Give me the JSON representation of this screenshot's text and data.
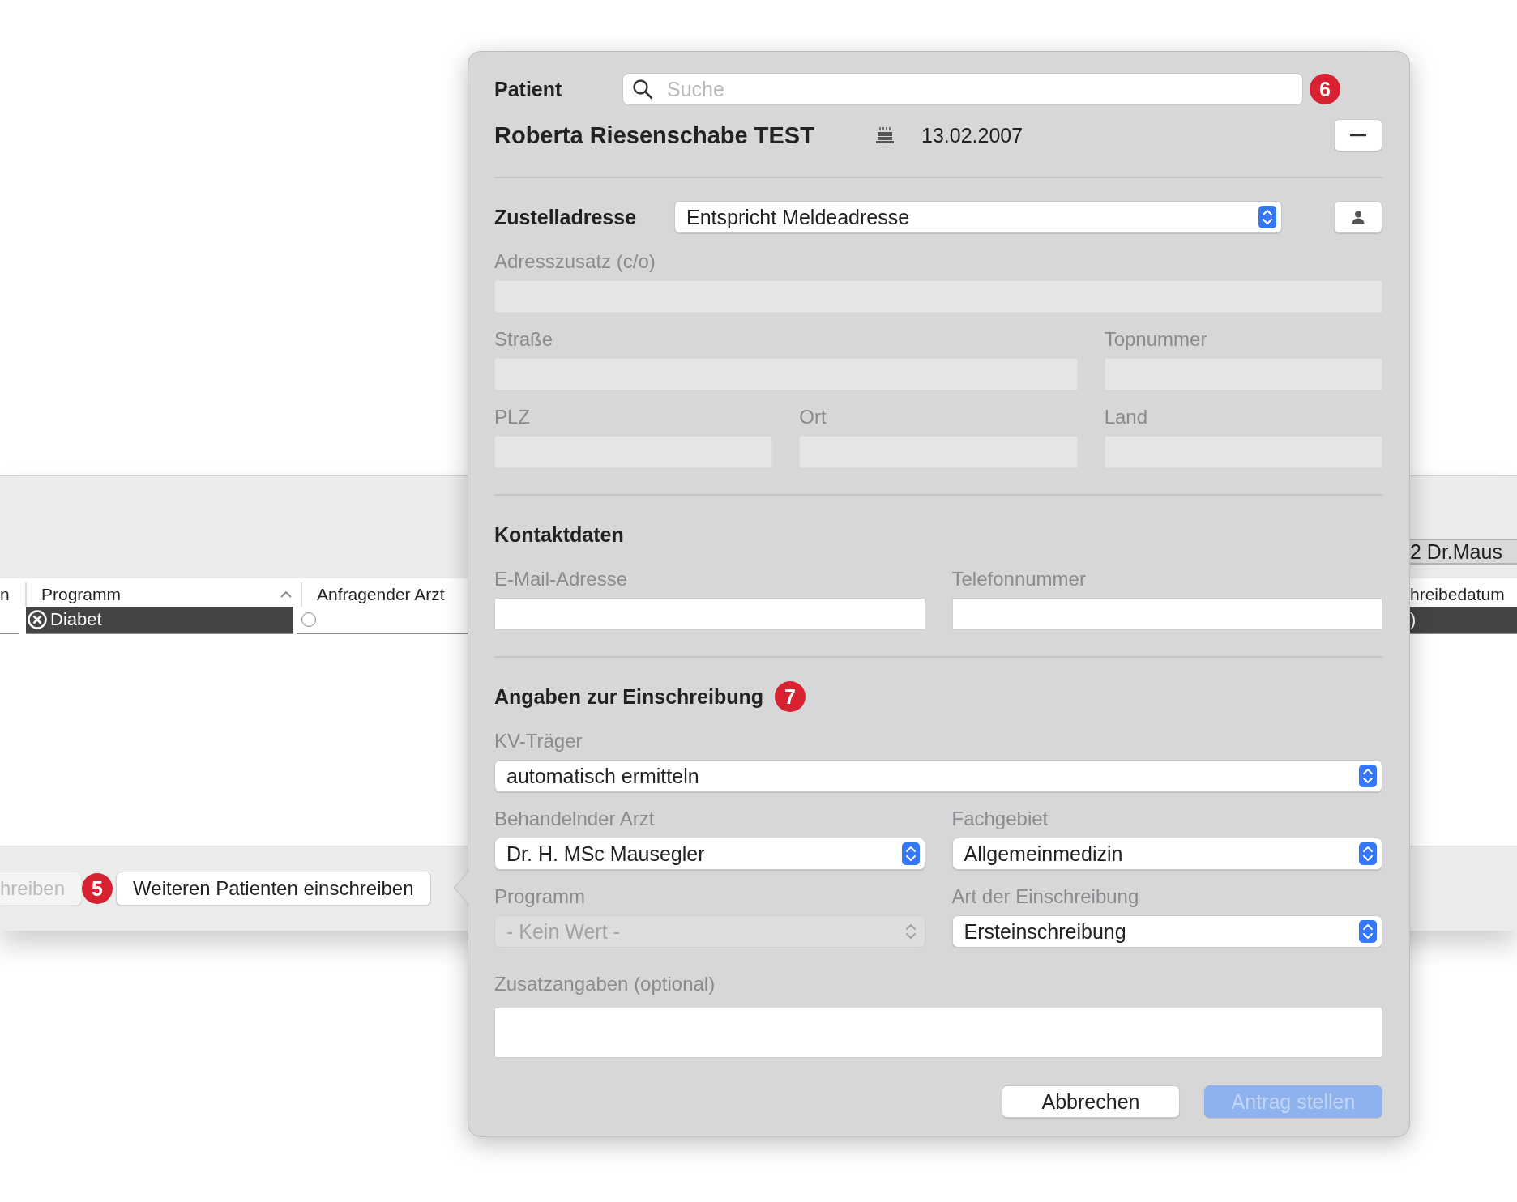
{
  "background_window": {
    "doctor_field": "2 Dr.Maus",
    "columns": [
      {
        "label": "n",
        "sorted": false
      },
      {
        "label": "Programm",
        "sorted": true
      },
      {
        "label": "Anfragender Arzt",
        "sorted": false
      },
      {
        "label": "hreibedatum",
        "sorted": false
      }
    ],
    "rows": [
      {
        "selected": true,
        "program": "Diabet",
        "requesting_doctor_checked": false,
        "column_4": ")"
      }
    ],
    "buttons": [
      {
        "label": "hreiben",
        "disabled": true
      },
      {
        "label": "Weiteren Patienten einschreiben",
        "disabled": false
      }
    ],
    "badge": "5"
  },
  "popover": {
    "patient": {
      "label": "Patient",
      "search_placeholder": "Suche",
      "badge": "6",
      "name": "Roberta Riesenschabe TEST",
      "birth_date": "13.02.2007"
    },
    "sections": [
      {
        "title": "Zustelladresse",
        "title_select": "Entspricht Meldeadresse",
        "rows": [
          [
            {
              "kind": "text",
              "label": "Adresszusatz (c/o)",
              "disabled": true
            },
            "",
            ""
          ],
          [
            {
              "kind": "text",
              "label": "Straße",
              "disabled": true
            },
            "",
            {
              "kind": "text",
              "label": "Topnummer",
              "disabled": true
            }
          ],
          [
            {
              "kind": "text",
              "label": "PLZ",
              "disabled": true
            },
            {
              "kind": "text",
              "label": "Ort",
              "disabled": true
            },
            {
              "kind": "text",
              "label": "Land",
              "disabled": true
            }
          ]
        ]
      },
      {
        "title": "Kontaktdaten",
        "rows": [
          [
            {
              "kind": "text",
              "label": "E-Mail-Adresse",
              "disabled": false
            },
            {
              "kind": "text",
              "label": "Telefonnummer",
              "disabled": false
            }
          ]
        ]
      },
      {
        "title": "Angaben zur Einschreibung",
        "badge": "7",
        "rows": [
          [
            {
              "kind": "select",
              "label": "KV-Träger",
              "value": "automatisch ermitteln",
              "disabled": false
            },
            ""
          ],
          [
            {
              "kind": "select",
              "label": "Behandelnder Arzt",
              "value": "Dr.  H. MSc Mausegler",
              "disabled": false
            },
            {
              "kind": "select",
              "label": "Fachgebiet",
              "value": "Allgemeinmedizin",
              "disabled": false
            }
          ],
          [
            {
              "kind": "select",
              "label": "Programm",
              "value": "- Kein Wert -",
              "disabled": true
            },
            {
              "kind": "select",
              "label": "Art der Einschreibung",
              "value": "Ersteinschreibung",
              "disabled": false
            }
          ],
          [
            {
              "kind": "textarea",
              "label": "Zusatzangaben (optional)",
              "disabled": false
            },
            ""
          ]
        ]
      }
    ],
    "buttons": [
      {
        "label": "Abbrechen",
        "primary": false,
        "disabled": false
      },
      {
        "label": "Antrag stellen",
        "primary": true,
        "disabled": true
      }
    ]
  }
}
